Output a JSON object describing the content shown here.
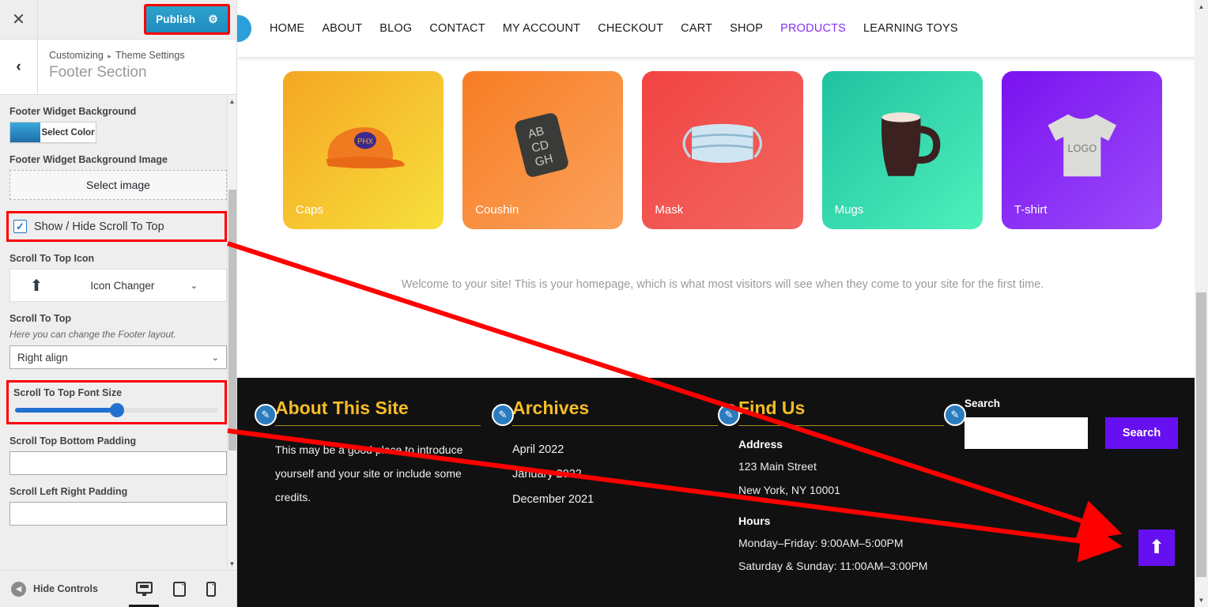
{
  "customizer": {
    "close_icon": "✕",
    "back_icon": "‹",
    "publish_label": "Publish",
    "gear_icon": "⚙",
    "breadcrumb_root": "Customizing",
    "breadcrumb_sep": "▸",
    "breadcrumb_parent": "Theme Settings",
    "section_title": "Footer Section",
    "controls": {
      "footer_widget_background_label": "Footer Widget Background",
      "select_color_label": "Select Color",
      "footer_widget_bg_image_label": "Footer Widget Background Image",
      "select_image_label": "Select image",
      "show_hide_scroll_label": "Show / Hide Scroll To Top",
      "show_hide_scroll_checked": true,
      "check_glyph": "✓",
      "scroll_icon_label": "Scroll To Top Icon",
      "icon_changer_label": "Icon Changer",
      "icon_changer_glyph": "⬆",
      "caret_glyph": "⌄",
      "scroll_to_top_label": "Scroll To Top",
      "scroll_to_top_desc": "Here you can change the Footer layout.",
      "layout_value": "Right align",
      "font_size_label": "Scroll To Top Font Size",
      "font_size_percent": 50,
      "top_bottom_padding_label": "Scroll Top Bottom Padding",
      "top_bottom_padding_value": "",
      "left_right_padding_label": "Scroll Left Right Padding",
      "left_right_padding_value": ""
    },
    "footer_bar": {
      "hide_controls_label": "Hide Controls",
      "hide_icon": "◀",
      "devices": [
        {
          "name": "desktop-preview",
          "glyph": "🖥",
          "active": true
        },
        {
          "name": "tablet-preview",
          "glyph": "▣",
          "active": false
        },
        {
          "name": "mobile-preview",
          "glyph": "▯",
          "active": false
        }
      ]
    },
    "scrollbar": {
      "up": "▲",
      "down": "▼"
    }
  },
  "preview": {
    "nav": [
      {
        "label": "HOME",
        "active": false
      },
      {
        "label": "ABOUT",
        "active": false
      },
      {
        "label": "BLOG",
        "active": false
      },
      {
        "label": "CONTACT",
        "active": false
      },
      {
        "label": "MY ACCOUNT",
        "active": false
      },
      {
        "label": "CHECKOUT",
        "active": false
      },
      {
        "label": "CART",
        "active": false
      },
      {
        "label": "SHOP",
        "active": false
      },
      {
        "label": "PRODUCTS",
        "active": true
      },
      {
        "label": "LEARNING TOYS",
        "active": false
      }
    ],
    "products": [
      {
        "label": "Caps",
        "grad_from": "#f5a623",
        "grad_to": "#f7e03c"
      },
      {
        "label": "Coushin",
        "grad_from": "#f77d23",
        "grad_to": "#fba15c"
      },
      {
        "label": "Mask",
        "grad_from": "#f24444",
        "grad_to": "#f2675f"
      },
      {
        "label": "Mugs",
        "grad_from": "#1fc2a0",
        "grad_to": "#4ef0bb"
      },
      {
        "label": "T-shirt",
        "grad_from": "#7a12f0",
        "grad_to": "#9b4bfb"
      }
    ],
    "welcome_text": "Welcome to your site! This is your homepage, which is what most visitors will see when they come to your site for the first time.",
    "footer": {
      "edit_icon": "✎",
      "about": {
        "heading": "About This Site",
        "body": "This may be a good place to introduce yourself and your site or include some credits."
      },
      "archives": {
        "heading": "Archives",
        "items": [
          "April 2022",
          "January 2022",
          "December 2021"
        ]
      },
      "find_us": {
        "heading": "Find Us",
        "address_label": "Address",
        "address_line1": "123 Main Street",
        "address_line2": "New York, NY 10001",
        "hours_label": "Hours",
        "hours_line1": "Monday–Friday: 9:00AM–5:00PM",
        "hours_line2": "Saturday & Sunday: 11:00AM–3:00PM"
      },
      "search": {
        "heading": "Search",
        "input_value": "",
        "button_label": "Search"
      }
    },
    "scroll_top_button": {
      "arrow": "⬆",
      "color": "#6610f2"
    },
    "scrollbar": {
      "up": "▲",
      "down": "▼"
    }
  },
  "annotations": {
    "highlight_color": "#ff0000",
    "arrow_color": "#ff0000"
  }
}
